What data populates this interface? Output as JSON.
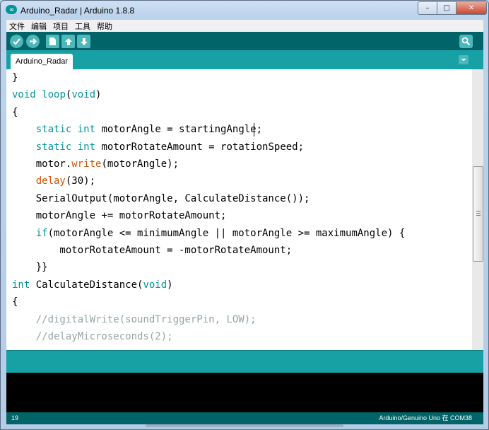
{
  "window": {
    "title": "Arduino_Radar | Arduino 1.8.8",
    "icon_text": "∞",
    "buttons": [
      "minimize-icon",
      "maximize-icon",
      "close-icon"
    ]
  },
  "menu": [
    "文件",
    "编辑",
    "项目",
    "工具",
    "帮助"
  ],
  "toolbar": {
    "buttons": [
      "verify-icon",
      "upload-icon",
      "new-icon",
      "open-icon",
      "save-icon"
    ],
    "serial_monitor": "serial-monitor-icon"
  },
  "tabs": [
    {
      "label": "Arduino_Radar"
    }
  ],
  "editor": {
    "current_line": 19
  },
  "status": {
    "line": "19",
    "board": "Arduino/Genuino Uno 在 COM38"
  },
  "colors": {
    "toolbar": "#006468",
    "tabs": "#17a1a5",
    "keyword": "#00979c",
    "function": "#d35400",
    "comment": "#95a5a6"
  }
}
